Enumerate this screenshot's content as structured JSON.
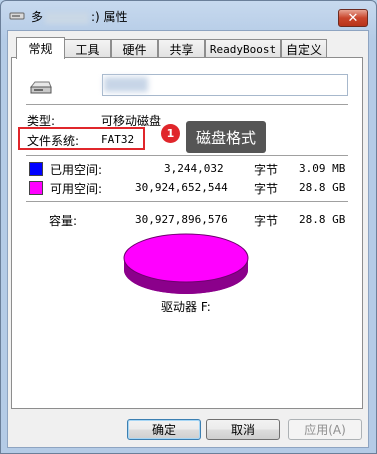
{
  "window": {
    "title_prefix": "多",
    "title_suffix": ":) 属性",
    "close_label": "✕"
  },
  "tabs": [
    {
      "label": "常规"
    },
    {
      "label": "工具"
    },
    {
      "label": "硬件"
    },
    {
      "label": "共享"
    },
    {
      "label": "ReadyBoost"
    },
    {
      "label": "自定义"
    }
  ],
  "general": {
    "name_value": "",
    "type_label": "类型:",
    "type_value": "可移动磁盘",
    "fs_label": "文件系统:",
    "fs_value": "FAT32",
    "used_label": "已用空间:",
    "used_bytes": "3,244,032",
    "used_unit": "字节",
    "used_human": "3.09 MB",
    "free_label": "可用空间:",
    "free_bytes": "30,924,652,544",
    "free_unit": "字节",
    "free_human": "28.8 GB",
    "cap_label": "容量:",
    "cap_bytes": "30,927,896,576",
    "cap_unit": "字节",
    "cap_human": "28.8 GB",
    "drive_label": "驱动器 F:"
  },
  "annotation": {
    "badge": "1",
    "text": "磁盘格式"
  },
  "colors": {
    "used": "#0000ff",
    "free": "#ff00ff",
    "highlight": "#e0262b"
  },
  "buttons": {
    "ok": "确定",
    "cancel": "取消",
    "apply": "应用(A)"
  }
}
